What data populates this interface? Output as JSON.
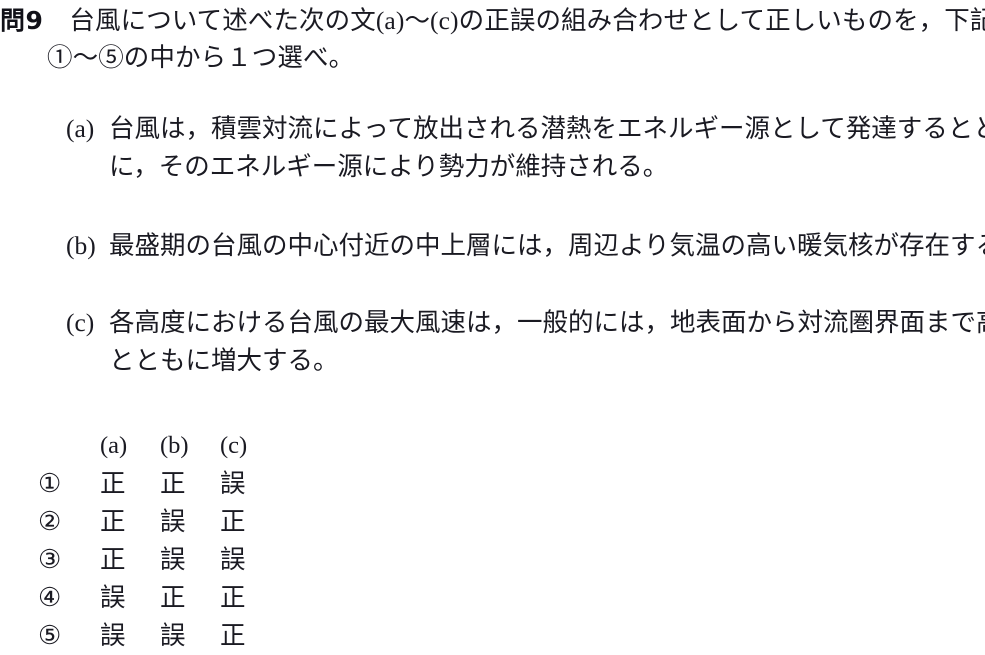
{
  "question": {
    "number": "問9",
    "stem_lines": [
      "台風について述べた次の文(a)〜(c)の正誤の組み合わせとして正しいものを，下記の",
      "①〜⑤の中から１つ選べ。"
    ]
  },
  "statements": [
    {
      "label": "(a)",
      "lines": [
        "台風は，積雲対流によって放出される潜熱をエネルギー源として発達するととも",
        "に，そのエネルギー源により勢力が維持される。"
      ]
    },
    {
      "label": "(b)",
      "lines": [
        "最盛期の台風の中心付近の中上層には，周辺より気温の高い暖気核が存在する。"
      ]
    },
    {
      "label": "(c)",
      "lines": [
        "各高度における台風の最大風速は，一般的には，地表面から対流圏界面まで高さ",
        "とともに増大する。"
      ]
    }
  ],
  "answer_table": {
    "headers": [
      "(a)",
      "(b)",
      "(c)"
    ],
    "rows": [
      {
        "key": "①",
        "values": [
          "正",
          "正",
          "誤"
        ]
      },
      {
        "key": "②",
        "values": [
          "正",
          "誤",
          "正"
        ]
      },
      {
        "key": "③",
        "values": [
          "正",
          "誤",
          "誤"
        ]
      },
      {
        "key": "④",
        "values": [
          "誤",
          "正",
          "正"
        ]
      },
      {
        "key": "⑤",
        "values": [
          "誤",
          "誤",
          "正"
        ]
      }
    ]
  },
  "colors": {
    "text": "#1a1a22",
    "background": "#ffffff"
  }
}
